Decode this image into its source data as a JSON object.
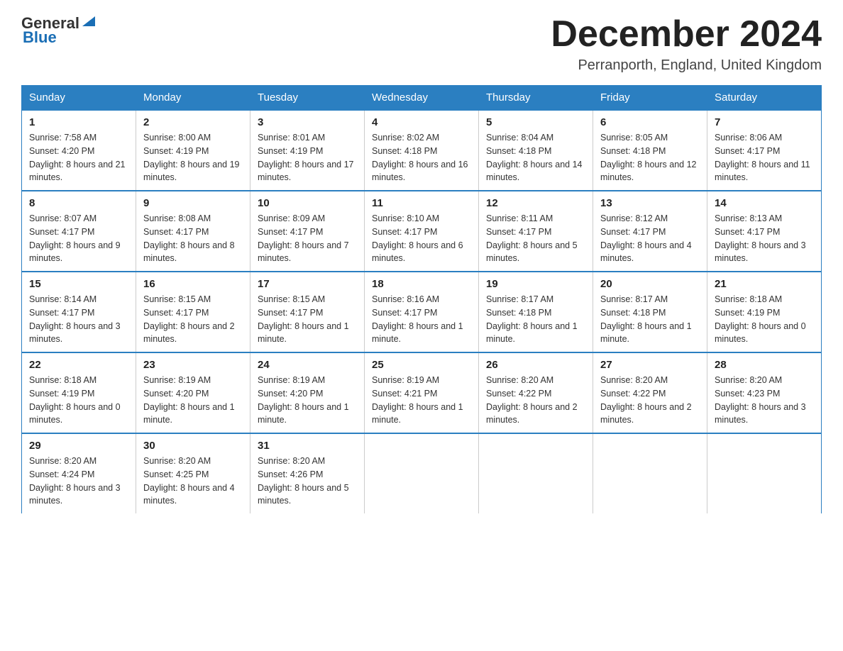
{
  "logo": {
    "text_general": "General",
    "text_blue": "Blue",
    "triangle_symbol": "▶"
  },
  "title": "December 2024",
  "location": "Perranporth, England, United Kingdom",
  "days_of_week": [
    "Sunday",
    "Monday",
    "Tuesday",
    "Wednesday",
    "Thursday",
    "Friday",
    "Saturday"
  ],
  "weeks": [
    [
      {
        "day": "1",
        "sunrise": "Sunrise: 7:58 AM",
        "sunset": "Sunset: 4:20 PM",
        "daylight": "Daylight: 8 hours and 21 minutes."
      },
      {
        "day": "2",
        "sunrise": "Sunrise: 8:00 AM",
        "sunset": "Sunset: 4:19 PM",
        "daylight": "Daylight: 8 hours and 19 minutes."
      },
      {
        "day": "3",
        "sunrise": "Sunrise: 8:01 AM",
        "sunset": "Sunset: 4:19 PM",
        "daylight": "Daylight: 8 hours and 17 minutes."
      },
      {
        "day": "4",
        "sunrise": "Sunrise: 8:02 AM",
        "sunset": "Sunset: 4:18 PM",
        "daylight": "Daylight: 8 hours and 16 minutes."
      },
      {
        "day": "5",
        "sunrise": "Sunrise: 8:04 AM",
        "sunset": "Sunset: 4:18 PM",
        "daylight": "Daylight: 8 hours and 14 minutes."
      },
      {
        "day": "6",
        "sunrise": "Sunrise: 8:05 AM",
        "sunset": "Sunset: 4:18 PM",
        "daylight": "Daylight: 8 hours and 12 minutes."
      },
      {
        "day": "7",
        "sunrise": "Sunrise: 8:06 AM",
        "sunset": "Sunset: 4:17 PM",
        "daylight": "Daylight: 8 hours and 11 minutes."
      }
    ],
    [
      {
        "day": "8",
        "sunrise": "Sunrise: 8:07 AM",
        "sunset": "Sunset: 4:17 PM",
        "daylight": "Daylight: 8 hours and 9 minutes."
      },
      {
        "day": "9",
        "sunrise": "Sunrise: 8:08 AM",
        "sunset": "Sunset: 4:17 PM",
        "daylight": "Daylight: 8 hours and 8 minutes."
      },
      {
        "day": "10",
        "sunrise": "Sunrise: 8:09 AM",
        "sunset": "Sunset: 4:17 PM",
        "daylight": "Daylight: 8 hours and 7 minutes."
      },
      {
        "day": "11",
        "sunrise": "Sunrise: 8:10 AM",
        "sunset": "Sunset: 4:17 PM",
        "daylight": "Daylight: 8 hours and 6 minutes."
      },
      {
        "day": "12",
        "sunrise": "Sunrise: 8:11 AM",
        "sunset": "Sunset: 4:17 PM",
        "daylight": "Daylight: 8 hours and 5 minutes."
      },
      {
        "day": "13",
        "sunrise": "Sunrise: 8:12 AM",
        "sunset": "Sunset: 4:17 PM",
        "daylight": "Daylight: 8 hours and 4 minutes."
      },
      {
        "day": "14",
        "sunrise": "Sunrise: 8:13 AM",
        "sunset": "Sunset: 4:17 PM",
        "daylight": "Daylight: 8 hours and 3 minutes."
      }
    ],
    [
      {
        "day": "15",
        "sunrise": "Sunrise: 8:14 AM",
        "sunset": "Sunset: 4:17 PM",
        "daylight": "Daylight: 8 hours and 3 minutes."
      },
      {
        "day": "16",
        "sunrise": "Sunrise: 8:15 AM",
        "sunset": "Sunset: 4:17 PM",
        "daylight": "Daylight: 8 hours and 2 minutes."
      },
      {
        "day": "17",
        "sunrise": "Sunrise: 8:15 AM",
        "sunset": "Sunset: 4:17 PM",
        "daylight": "Daylight: 8 hours and 1 minute."
      },
      {
        "day": "18",
        "sunrise": "Sunrise: 8:16 AM",
        "sunset": "Sunset: 4:17 PM",
        "daylight": "Daylight: 8 hours and 1 minute."
      },
      {
        "day": "19",
        "sunrise": "Sunrise: 8:17 AM",
        "sunset": "Sunset: 4:18 PM",
        "daylight": "Daylight: 8 hours and 1 minute."
      },
      {
        "day": "20",
        "sunrise": "Sunrise: 8:17 AM",
        "sunset": "Sunset: 4:18 PM",
        "daylight": "Daylight: 8 hours and 1 minute."
      },
      {
        "day": "21",
        "sunrise": "Sunrise: 8:18 AM",
        "sunset": "Sunset: 4:19 PM",
        "daylight": "Daylight: 8 hours and 0 minutes."
      }
    ],
    [
      {
        "day": "22",
        "sunrise": "Sunrise: 8:18 AM",
        "sunset": "Sunset: 4:19 PM",
        "daylight": "Daylight: 8 hours and 0 minutes."
      },
      {
        "day": "23",
        "sunrise": "Sunrise: 8:19 AM",
        "sunset": "Sunset: 4:20 PM",
        "daylight": "Daylight: 8 hours and 1 minute."
      },
      {
        "day": "24",
        "sunrise": "Sunrise: 8:19 AM",
        "sunset": "Sunset: 4:20 PM",
        "daylight": "Daylight: 8 hours and 1 minute."
      },
      {
        "day": "25",
        "sunrise": "Sunrise: 8:19 AM",
        "sunset": "Sunset: 4:21 PM",
        "daylight": "Daylight: 8 hours and 1 minute."
      },
      {
        "day": "26",
        "sunrise": "Sunrise: 8:20 AM",
        "sunset": "Sunset: 4:22 PM",
        "daylight": "Daylight: 8 hours and 2 minutes."
      },
      {
        "day": "27",
        "sunrise": "Sunrise: 8:20 AM",
        "sunset": "Sunset: 4:22 PM",
        "daylight": "Daylight: 8 hours and 2 minutes."
      },
      {
        "day": "28",
        "sunrise": "Sunrise: 8:20 AM",
        "sunset": "Sunset: 4:23 PM",
        "daylight": "Daylight: 8 hours and 3 minutes."
      }
    ],
    [
      {
        "day": "29",
        "sunrise": "Sunrise: 8:20 AM",
        "sunset": "Sunset: 4:24 PM",
        "daylight": "Daylight: 8 hours and 3 minutes."
      },
      {
        "day": "30",
        "sunrise": "Sunrise: 8:20 AM",
        "sunset": "Sunset: 4:25 PM",
        "daylight": "Daylight: 8 hours and 4 minutes."
      },
      {
        "day": "31",
        "sunrise": "Sunrise: 8:20 AM",
        "sunset": "Sunset: 4:26 PM",
        "daylight": "Daylight: 8 hours and 5 minutes."
      },
      null,
      null,
      null,
      null
    ]
  ]
}
